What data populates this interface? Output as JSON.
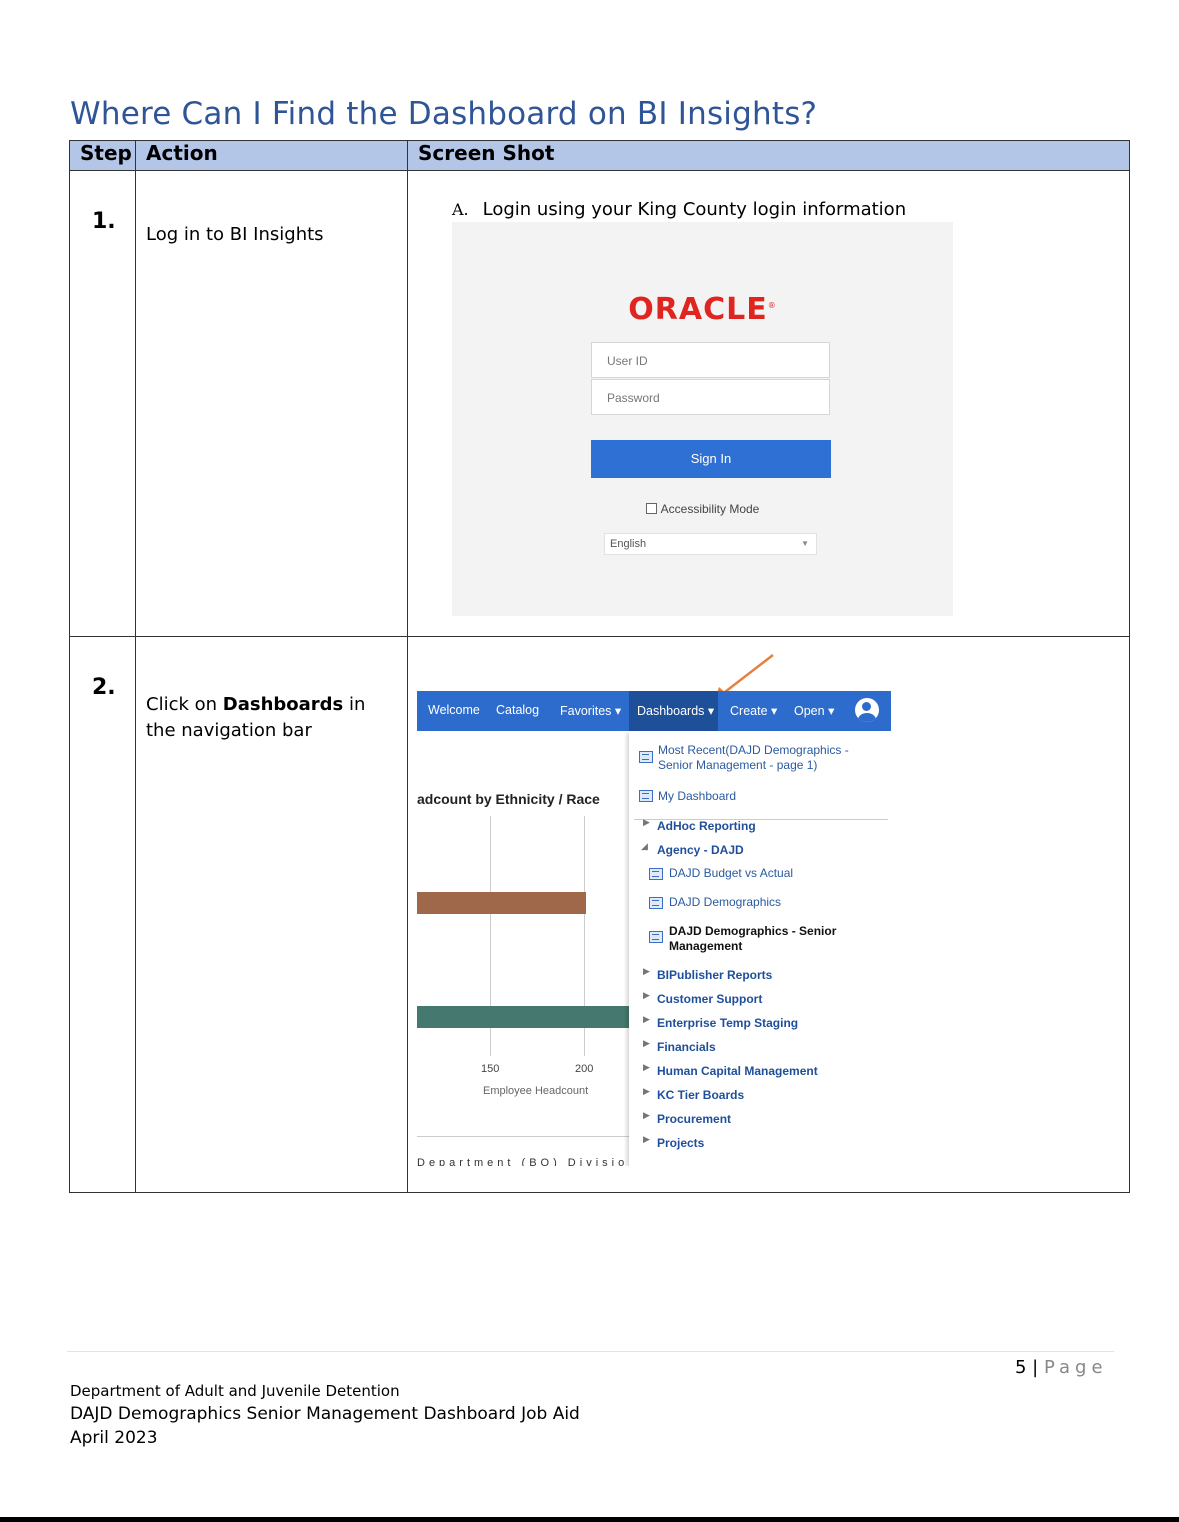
{
  "page": {
    "title": "Where Can I Find the Dashboard on BI Insights?"
  },
  "table": {
    "headers": {
      "step": "Step",
      "action": "Action",
      "screenshot": "Screen Shot"
    },
    "rows": [
      {
        "step": "1.",
        "action": "Log in to BI Insights",
        "instruction_letter": "A.",
        "instruction": "Login using your King County login information"
      },
      {
        "step": "2.",
        "action_prefix": "Click on ",
        "action_bold": "Dashboards",
        "action_suffix": " in the navigation bar"
      }
    ]
  },
  "login": {
    "logo": "ORACLE",
    "logo_mark": "®",
    "user_id_placeholder": "User ID",
    "password_placeholder": "Password",
    "sign_in": "Sign In",
    "accessibility": "Accessibility Mode",
    "language": "English",
    "colors": {
      "logo": "#e0241f",
      "button": "#2f70d4",
      "panel": "#f3f3f3"
    }
  },
  "dashboard_shot": {
    "nav": {
      "welcome": "Welcome",
      "catalog": "Catalog",
      "favorites": "Favorites",
      "dashboards": "Dashboards",
      "create": "Create",
      "open": "Open"
    },
    "chart_title": "adcount by Ethnicity / Race",
    "x_ticks": [
      "150",
      "200"
    ],
    "x_label": "Employee Headcount",
    "cutoff_text": "Department (BO)  Division (BO)  Section (BO)  Job Cl",
    "menu": {
      "most_recent": "Most Recent(DAJD Demographics - Senior Management - page 1)",
      "most_recent_line1": "Most Recent(DAJD Demographics -",
      "most_recent_line2": "Senior Management - page 1)",
      "my_dashboard": "My Dashboard",
      "adhoc": "AdHoc Reporting",
      "agency": "Agency - DAJD",
      "budget": "DAJD Budget vs Actual",
      "demographics": "DAJD Demographics",
      "senior_line1": "DAJD Demographics - Senior",
      "senior_line2": "Management",
      "bipublisher": "BIPublisher Reports",
      "customer_support": "Customer Support",
      "enterprise": "Enterprise Temp Staging",
      "financials": "Financials",
      "hcm": "Human Capital Management",
      "kc_tier": "KC Tier Boards",
      "procurement": "Procurement",
      "projects": "Projects"
    },
    "colors": {
      "nav": "#2d6ccc",
      "nav_active": "#1e4f99",
      "arrow": "#e8803a",
      "bar1": "#a0684a",
      "bar2": "#45786e"
    }
  },
  "footer": {
    "page_number": "5",
    "page_sep": " | ",
    "page_word": "Page",
    "line1": "Department of Adult and Juvenile Detention",
    "line2": "DAJD Demographics Senior Management Dashboard Job Aid",
    "line3": "April 2023"
  }
}
